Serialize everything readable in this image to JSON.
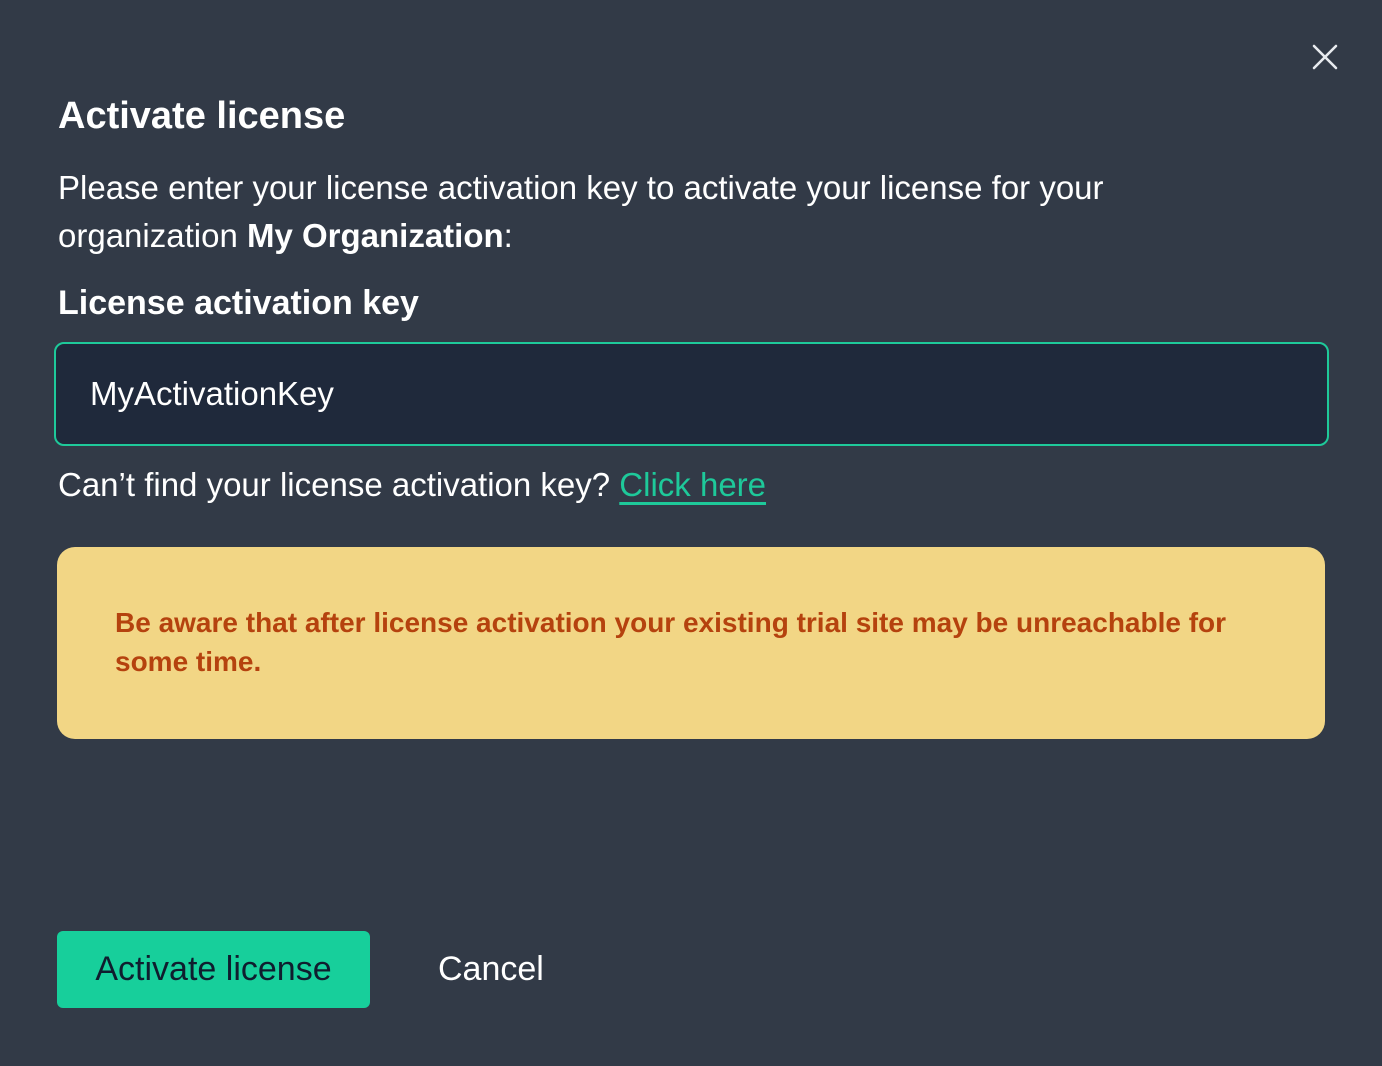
{
  "dialog": {
    "title": "Activate license",
    "intro_text": "Please enter your license activation key to activate your license for your organization ",
    "organization_name": "My Organization",
    "intro_suffix": ":",
    "field_label": "License activation key",
    "input_value": "MyActivationKey",
    "help_text": "Can’t find your license activation key? ",
    "help_link": "Click here",
    "warning_text": "Be aware that after license activation your existing trial site may be unreachable for some time.",
    "activate_label": "Activate license",
    "cancel_label": "Cancel",
    "close_icon": "close-icon"
  },
  "colors": {
    "background": "#323a47",
    "accent": "#17cf9b",
    "input_bg": "#1f293b",
    "warning_bg": "#f2d685",
    "warning_text": "#b5420e"
  }
}
